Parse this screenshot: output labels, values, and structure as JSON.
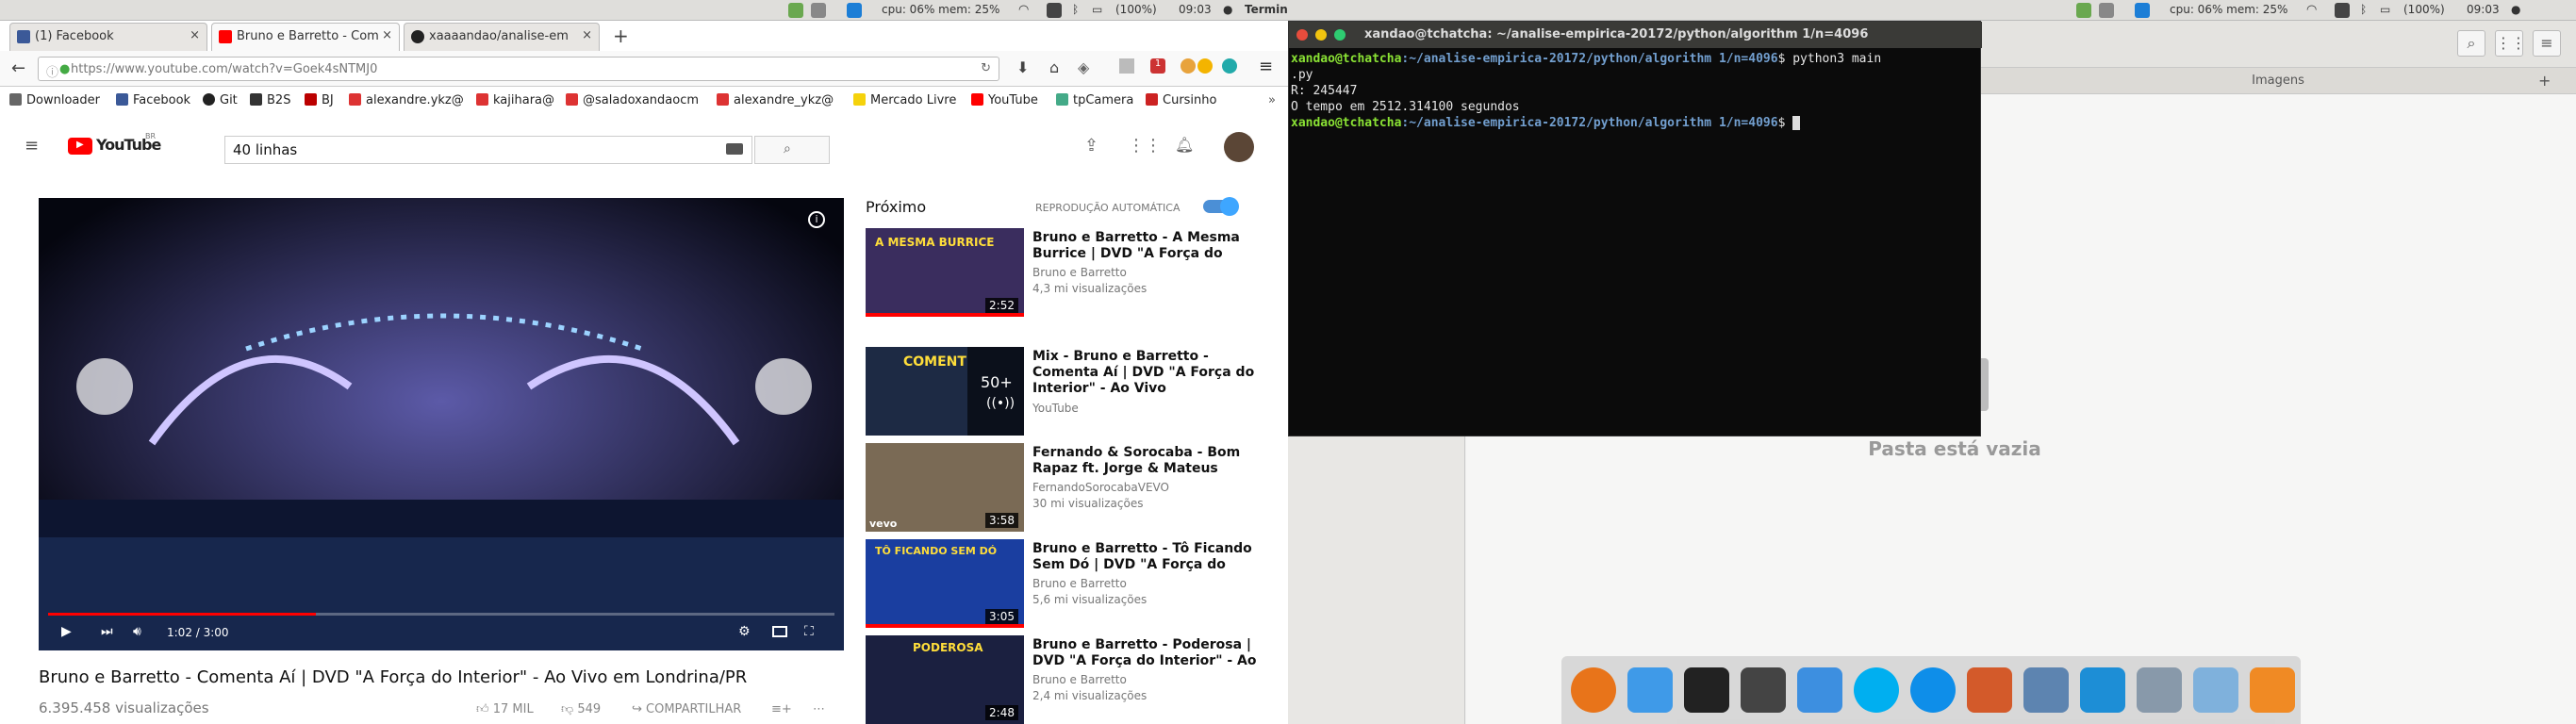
{
  "topbar": {
    "cpu": "cpu: 06% mem: 25%",
    "battery": "(100%)",
    "time": "09:03",
    "app": "Terminal"
  },
  "tabs": [
    {
      "label": "(1) Facebook"
    },
    {
      "label": "Bruno e Barretto - Com"
    },
    {
      "label": "xaaaandao/analise-em"
    }
  ],
  "browser": {
    "url": "https://www.youtube.com/watch?v=Goek4sNTMJ0",
    "badge": "1"
  },
  "bookmarks": [
    "Downloader",
    "Facebook",
    "Git",
    "B2S",
    "BJ",
    "alexandre.ykz@",
    "kajihara@",
    "@saladoxandaocm",
    "alexandre_ykz@",
    "Mercado Livre",
    "YouTube",
    "tpCamera",
    "Cursinho"
  ],
  "youtube": {
    "logo": "YouTube",
    "logo_sup": "BR",
    "search": "40 linhas",
    "time": "1:02 / 3:00",
    "title": "Bruno e Barretto - Comenta Aí | DVD \"A Força do Interior\" - Ao Vivo em Londrina/PR",
    "views": "6.395.458 visualizações",
    "likes": "17 MIL",
    "dislikes": "549",
    "share": "COMPARTILHAR",
    "next": "Próximo",
    "autoplay": "REPRODUÇÃO AUTOMÁTICA"
  },
  "recs": [
    {
      "title": "Bruno e Barretto - A Mesma Burrice | DVD \"A Força do",
      "channel": "Bruno e Barretto",
      "views": "4,3 mi visualizações",
      "dur": "2:52",
      "thumbtext": "A MESMA BURRICE"
    },
    {
      "title": "Mix - Bruno e Barretto - Comenta Aí | DVD \"A Força do Interior\" - Ao Vivo",
      "channel": "YouTube",
      "views": "",
      "dur": "",
      "thumbtext": "COMENT",
      "mix": "50+"
    },
    {
      "title": "Fernando & Sorocaba - Bom Rapaz ft. Jorge & Mateus",
      "channel": "FernandoSorocabaVEVO",
      "views": "30 mi visualizações",
      "dur": "3:58",
      "thumbtext": "vevo"
    },
    {
      "title": "Bruno e Barretto - Tô Ficando Sem Dó | DVD \"A Força do",
      "channel": "Bruno e Barretto",
      "views": "5,6 mi visualizações",
      "dur": "3:05",
      "thumbtext": "TÔ FICANDO SEM DÓ"
    },
    {
      "title": "Bruno e Barretto - Poderosa | DVD \"A Força do Interior\" - Ao",
      "channel": "Bruno e Barretto",
      "views": "2,4 mi visualizações",
      "dur": "2:48",
      "thumbtext": "PODEROSA"
    }
  ],
  "terminal": {
    "title": "xandao@tchatcha: ~/analise-empirica-20172/python/algorithm 1/n=4096",
    "prompt_user": "xandao@tchatcha",
    "prompt_path": ":~/analise-empirica-20172/python/algorithm 1/n=4096",
    "cmd": "$ python3 main",
    "cmd2": ".py",
    "out1": "R: 245447",
    "out2": "O tempo em 2512.314100 segundos",
    "prompt_end": "$ "
  },
  "files": {
    "tab": "Imagens",
    "empty": "Pasta está vazia"
  },
  "colors": {
    "yt_red": "#ff0000",
    "term_green": "#8ae234",
    "term_blue": "#729fcf"
  }
}
